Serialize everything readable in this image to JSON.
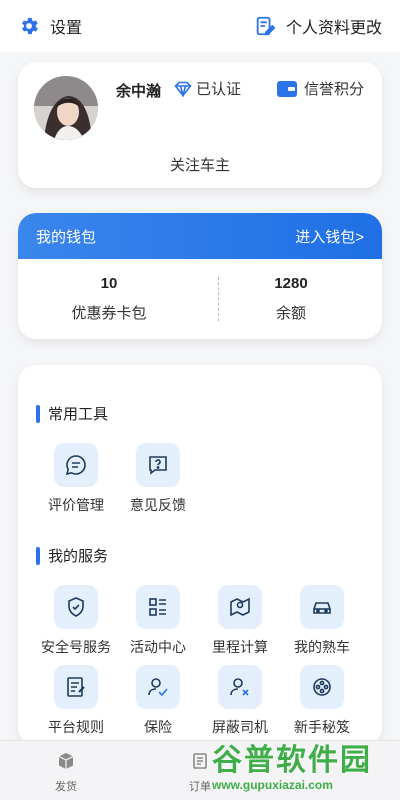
{
  "header": {
    "settings_label": "设置",
    "profile_edit_label": "个人资料更改"
  },
  "profile": {
    "name": "余中瀚",
    "verified_label": "已认证",
    "credit_label": "信誉积分",
    "follow_label": "关注车主"
  },
  "wallet": {
    "title": "我的钱包",
    "enter_label": "进入钱包>",
    "coupons_value": "10",
    "coupons_label": "优惠券卡包",
    "balance_value": "1280",
    "balance_label": "余额"
  },
  "common_tools": {
    "title": "常用工具",
    "items": [
      {
        "label": "评价管理",
        "icon": "chat-icon"
      },
      {
        "label": "意见反馈",
        "icon": "feedback-icon"
      }
    ]
  },
  "my_services": {
    "title": "我的服务",
    "items": [
      {
        "label": "安全号服务",
        "icon": "shield-icon"
      },
      {
        "label": "活动中心",
        "icon": "list-icon"
      },
      {
        "label": "里程计算",
        "icon": "map-icon"
      },
      {
        "label": "我的熟车",
        "icon": "car-icon"
      },
      {
        "label": "平台规则",
        "icon": "rules-icon"
      },
      {
        "label": "保险",
        "icon": "insurance-icon"
      },
      {
        "label": "屏蔽司机",
        "icon": "block-driver-icon"
      },
      {
        "label": "新手秘笈",
        "icon": "film-icon"
      }
    ]
  },
  "tabbar": {
    "tabs": [
      {
        "label": "发货",
        "icon": "box-icon"
      },
      {
        "label": "订单",
        "icon": "order-icon"
      }
    ]
  },
  "watermark": {
    "main": "谷普软件园",
    "url": "www.gupuxiazai.com"
  },
  "colors": {
    "accent": "#2a73ea",
    "icon_bg": "#e3f0fc",
    "watermark": "#3fae48"
  }
}
